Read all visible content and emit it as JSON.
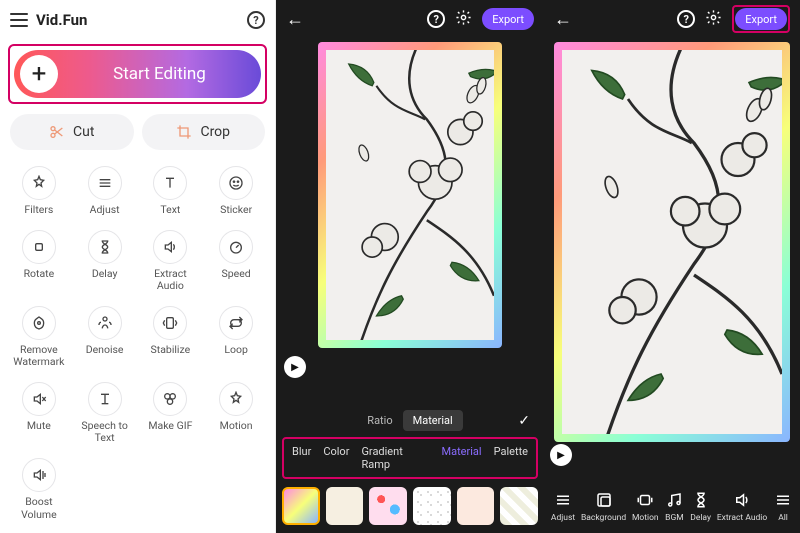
{
  "colors": {
    "accent": "#d40063",
    "export_btn": "#7c4dff",
    "chip_active": "#8a6cff"
  },
  "left": {
    "app_title": "Vid.Fun",
    "start_label": "Start Editing",
    "cut_label": "Cut",
    "crop_label": "Crop",
    "tools": [
      {
        "id": "filters",
        "label": "Filters"
      },
      {
        "id": "adjust",
        "label": "Adjust"
      },
      {
        "id": "text",
        "label": "Text"
      },
      {
        "id": "sticker",
        "label": "Sticker"
      },
      {
        "id": "rotate",
        "label": "Rotate"
      },
      {
        "id": "delay",
        "label": "Delay"
      },
      {
        "id": "extract-audio",
        "label": "Extract Audio"
      },
      {
        "id": "speed",
        "label": "Speed"
      },
      {
        "id": "remove-watermark",
        "label": "Remove Watermark"
      },
      {
        "id": "denoise",
        "label": "Denoise"
      },
      {
        "id": "stabilize",
        "label": "Stabilize"
      },
      {
        "id": "loop",
        "label": "Loop"
      },
      {
        "id": "mute",
        "label": "Mute"
      },
      {
        "id": "speech-to-text",
        "label": "Speech to Text"
      },
      {
        "id": "make-gif",
        "label": "Make GIF"
      },
      {
        "id": "motion",
        "label": "Motion"
      },
      {
        "id": "boost-volume",
        "label": "Boost Volume"
      }
    ]
  },
  "mid": {
    "export_label": "Export",
    "seg_tabs": {
      "ratio": "Ratio",
      "material": "Material",
      "active": "material"
    },
    "chips": [
      {
        "id": "blur",
        "label": "Blur"
      },
      {
        "id": "color",
        "label": "Color"
      },
      {
        "id": "gradient-ramp",
        "label": "Gradient Ramp"
      },
      {
        "id": "material",
        "label": "Material",
        "active": true
      },
      {
        "id": "palette",
        "label": "Palette"
      }
    ],
    "thumbs_count": 6,
    "selected_thumb": 0
  },
  "right": {
    "export_label": "Export",
    "toolbar": [
      {
        "id": "adjust",
        "label": "Adjust"
      },
      {
        "id": "background",
        "label": "Background"
      },
      {
        "id": "motion",
        "label": "Motion"
      },
      {
        "id": "bgm",
        "label": "BGM"
      },
      {
        "id": "delay",
        "label": "Delay"
      },
      {
        "id": "extract-audio",
        "label": "Extract Audio"
      },
      {
        "id": "all",
        "label": "All"
      }
    ]
  }
}
